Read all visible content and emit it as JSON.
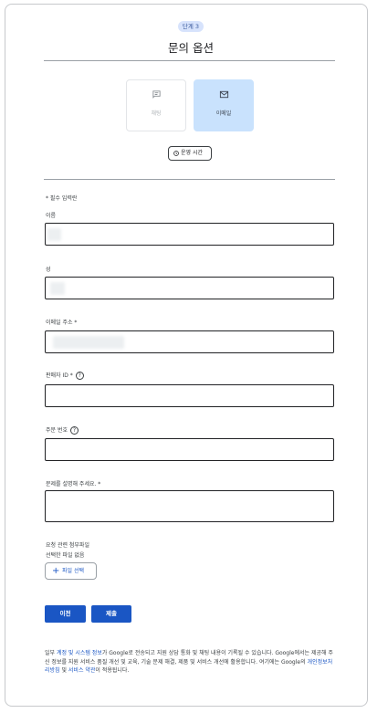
{
  "header": {
    "step_badge": "단계 3",
    "title": "문의 옵션"
  },
  "contact_options": [
    {
      "label": "채팅",
      "icon": "chat-icon",
      "selected": false
    },
    {
      "label": "이메일",
      "icon": "mail-icon",
      "selected": true
    }
  ],
  "hours_button": {
    "label": "운영 시간",
    "icon": "clock-icon"
  },
  "form": {
    "required_note": "* 필수 입력란",
    "first_name": {
      "label": "이름",
      "value": ""
    },
    "last_name": {
      "label": "성",
      "value": ""
    },
    "email": {
      "label": "이메일 주소 *",
      "value": ""
    },
    "seller_id": {
      "label": "판매자 ID *",
      "value": ""
    },
    "order_number": {
      "label": "주문 번호",
      "value": ""
    },
    "description": {
      "label": "문제를 설명해 주세요. *",
      "value": ""
    },
    "attachments": {
      "label": "요청 관련 첨부파일",
      "status": "선택한 파일 없음",
      "button_label": "파일 선택"
    },
    "help_glyph": "?"
  },
  "buttons": {
    "back": "이전",
    "submit": "제출"
  },
  "footer": {
    "t1": "일부 ",
    "link1": "계정 및 시스템 정보",
    "t2": "가 Google로 전송되고 지원 상담 통화 및 채팅 내용이 기록될 수 있습니다. Google에서는 제공해 주신 정보를 지원 서비스 품질 개선 및 교육, 기술 문제 해결, 제품 및 서비스 개선에 활용합니다. 여기에는 Google의 ",
    "link2": "개인정보처리방침",
    "t3": " 및 ",
    "link3": "서비스 약관",
    "t4": "이 적용됩니다."
  },
  "colors": {
    "primary": "#1a56c4",
    "selected_tile": "#c9e2fd",
    "badge_bg": "#d7e3fc"
  }
}
